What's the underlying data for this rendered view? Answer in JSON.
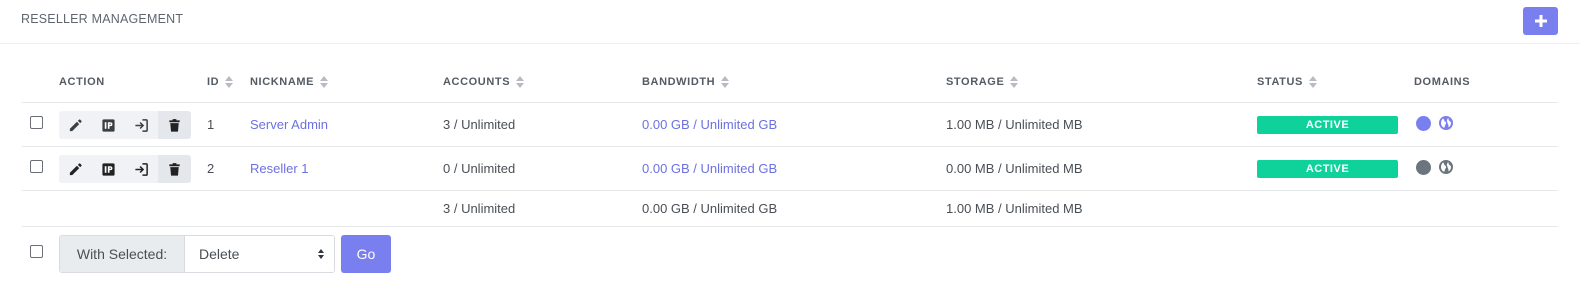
{
  "header": {
    "title": "RESELLER MANAGEMENT",
    "add_icon": "plus-icon",
    "accent": "#7a7ff0"
  },
  "table": {
    "columns": {
      "action": "ACTION",
      "id": "ID",
      "nickname": "NICKNAME",
      "accounts": "ACCOUNTS",
      "bandwidth": "BANDWIDTH",
      "storage": "STORAGE",
      "status": "STATUS",
      "domains": "DOMAINS"
    },
    "action_icons": [
      "pencil-icon",
      "ip-icon",
      "login-icon",
      "trash-icon"
    ],
    "rows": [
      {
        "id": "1",
        "nickname": "Server Admin",
        "accounts": "3 / Unlimited",
        "bandwidth": "0.00 GB / Unlimited GB",
        "storage": "1.00 MB / Unlimited MB",
        "status": "ACTIVE",
        "domain_dot_color": "#7a7ff0",
        "globe_color": "#7a7ff0"
      },
      {
        "id": "2",
        "nickname": "Reseller 1",
        "accounts": "0 / Unlimited",
        "bandwidth": "0.00 GB / Unlimited GB",
        "storage": "0.00 MB / Unlimited MB",
        "status": "ACTIVE",
        "domain_dot_color": "#6c757d",
        "globe_color": "#6c757d"
      }
    ],
    "totals": {
      "accounts": "3 / Unlimited",
      "bandwidth": "0.00 GB / Unlimited GB",
      "storage": "1.00 MB / Unlimited MB"
    },
    "status_color": "#0fd29b"
  },
  "bulk": {
    "label": "With Selected:",
    "selected_option": "Delete",
    "go_label": "Go"
  }
}
